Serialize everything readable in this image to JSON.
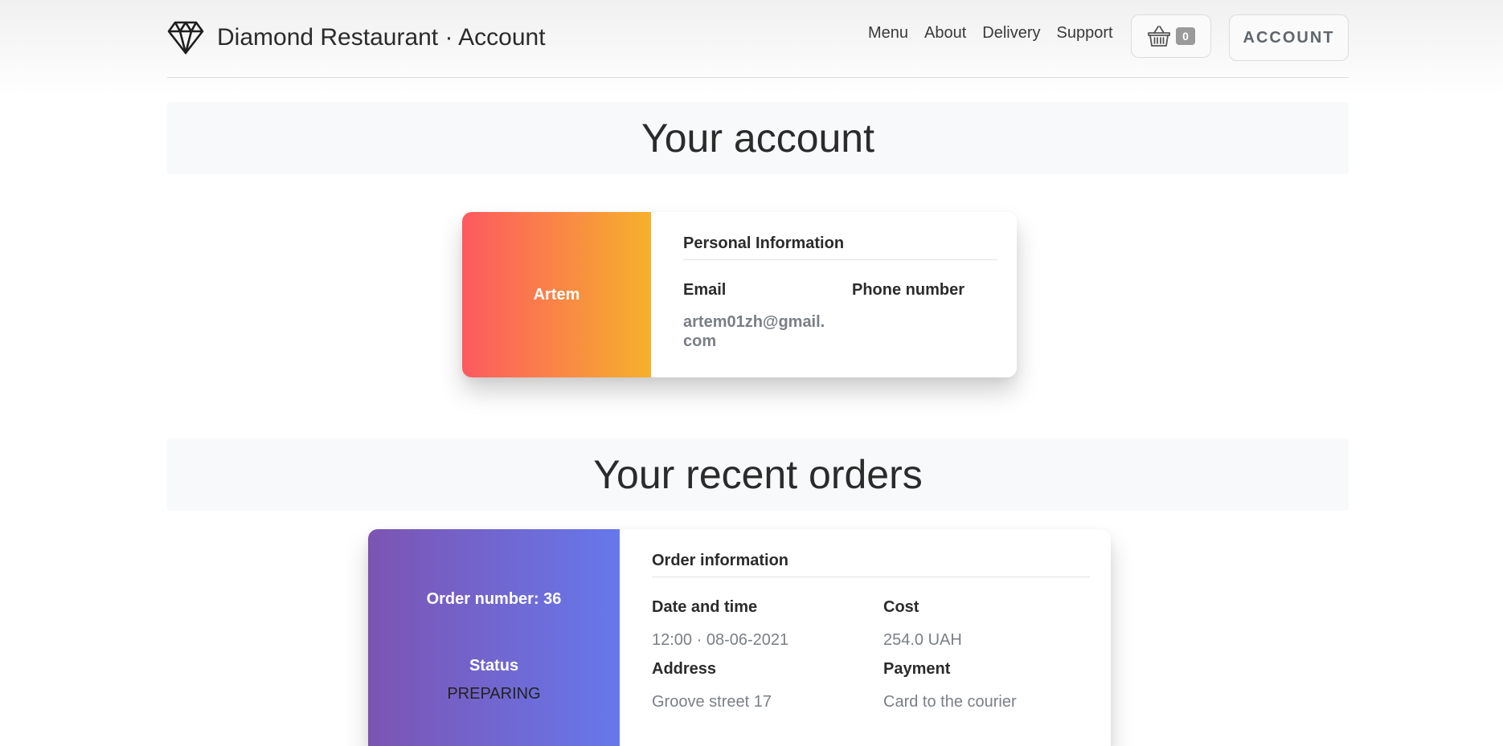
{
  "header": {
    "brand_title": "Diamond Restaurant · Account",
    "nav": [
      "Menu",
      "About",
      "Delivery",
      "Support"
    ],
    "cart_count": "0",
    "account_label": "ACCOUNT"
  },
  "account_section": {
    "title": "Your account",
    "user_name": "Artem",
    "heading": "Personal Information",
    "email_label": "Email",
    "email_value": "artem01zh@gmail.com",
    "phone_label": "Phone number",
    "phone_value": ""
  },
  "orders_section": {
    "title": "Your recent orders",
    "order": {
      "number_label": "Order number: 36",
      "status_label": "Status",
      "status_value": "PREPARING",
      "heading": "Order information",
      "datetime_label": "Date and time",
      "datetime_value": "12:00 · 08-06-2021",
      "cost_label": "Cost",
      "cost_value": "254.0 UAH",
      "address_label": "Address",
      "address_value": "Groove street 17",
      "payment_label": "Payment",
      "payment_value": "Card to the courier"
    }
  },
  "colors": {
    "account_gradient_start": "#fd5960",
    "account_gradient_end": "#f6b12c",
    "order_gradient_start": "#7d54b2",
    "order_gradient_end": "#6678ec"
  }
}
